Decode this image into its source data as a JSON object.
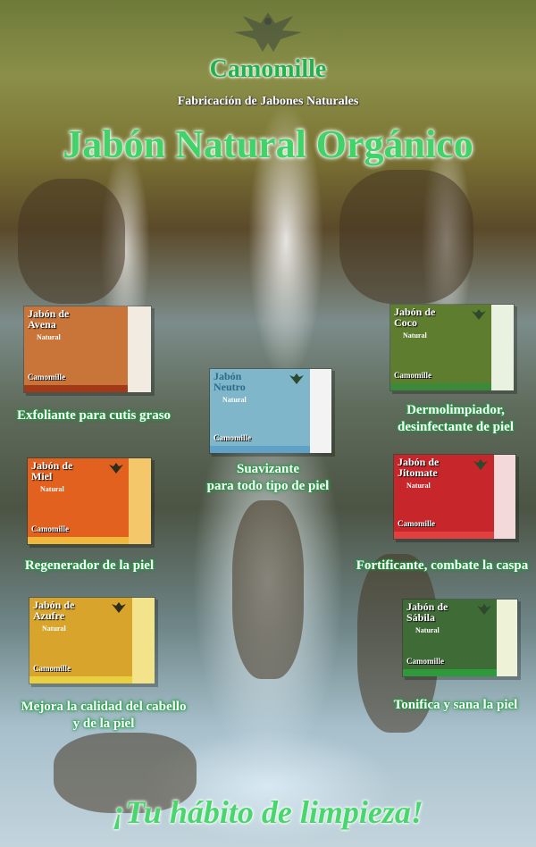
{
  "header": {
    "brand": "Camomille",
    "tagline": "Fabricación de Jabones Naturales",
    "headline": "Jabón Natural Orgánico"
  },
  "products": [
    {
      "box_name_line1": "Jabón de",
      "box_name_line2": "Avena",
      "box_natural": "Natural",
      "box_mark": "Camomille",
      "caption_line1": "Exfoliante para cutis graso",
      "caption_line2": "",
      "color": "#c9753a",
      "side_color": "#f2ebe1"
    },
    {
      "box_name_line1": "Jabón",
      "box_name_line2": "Neutro",
      "box_natural": "Natural",
      "box_mark": "Camomille",
      "caption_line1": "Suavizante",
      "caption_line2": "para todo tipo de piel",
      "color": "#7fb6c9",
      "side_color": "#f3f3f3"
    },
    {
      "box_name_line1": "Jabón de",
      "box_name_line2": "Coco",
      "box_natural": "Natural",
      "box_mark": "Camomille",
      "caption_line1": "Dermolimpiador,",
      "caption_line2": "desinfectante de piel",
      "color": "#5f7d2f",
      "side_color": "#e9f1e0"
    },
    {
      "box_name_line1": "Jabón de",
      "box_name_line2": "Miel",
      "box_natural": "Natural",
      "box_mark": "Camomille",
      "caption_line1": "Regenerador de la piel",
      "caption_line2": "",
      "color": "#e3611f",
      "side_color": "#f4c86a"
    },
    {
      "box_name_line1": "Jabón de",
      "box_name_line2": "Jitomate",
      "box_natural": "Natural",
      "box_mark": "Camomille",
      "caption_line1": "Fortificante, combate la caspa",
      "caption_line2": "",
      "color": "#c7262a",
      "side_color": "#f3d9d9"
    },
    {
      "box_name_line1": "Jabón de",
      "box_name_line2": "Azufre",
      "box_natural": "Natural",
      "box_mark": "Camomille",
      "caption_line1": "Mejora la calidad del cabello",
      "caption_line2": "y de la piel",
      "color": "#d9a42b",
      "side_color": "#f3e38a"
    },
    {
      "box_name_line1": "Jabón de",
      "box_name_line2": "Sábila",
      "box_natural": "Natural",
      "box_mark": "Camomille",
      "caption_line1": "Tonifica y sana la piel",
      "caption_line2": "",
      "color": "#3e6b36",
      "side_color": "#eef2d6"
    }
  ],
  "slogan": "¡Tu hábito de limpieza!"
}
